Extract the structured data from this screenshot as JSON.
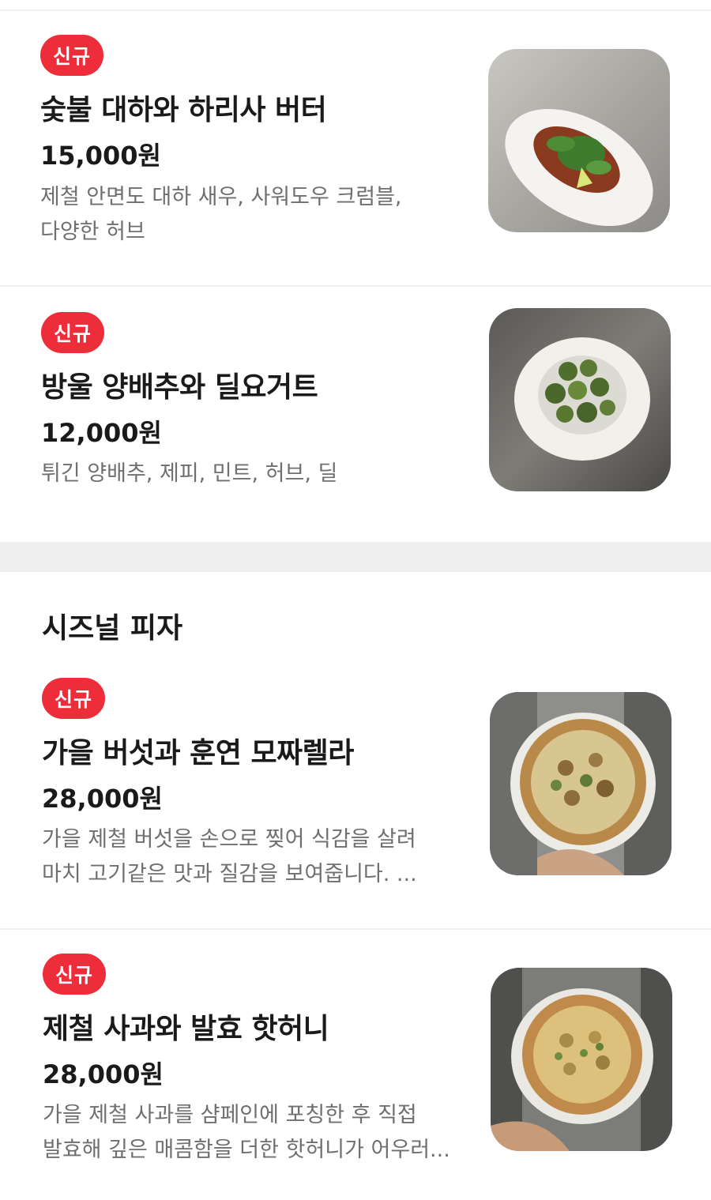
{
  "sections": [
    {
      "title": "",
      "items": [
        {
          "badge": "신규",
          "name": "숯불 대하와 하리사 버터",
          "price": "15,000원",
          "description": "제철 안면도 대하 새우, 사워도우 크럼블,\n다양한 허브"
        },
        {
          "badge": "신규",
          "name": "방울 양배추와 딜요거트",
          "price": "12,000원",
          "description": "튀긴 양배추, 제피, 민트, 허브, 딜"
        }
      ]
    },
    {
      "title": "시즈널 피자",
      "items": [
        {
          "badge": "신규",
          "name": "가을 버섯과 훈연 모짜렐라",
          "price": "28,000원",
          "description": "가을 제철 버섯을 손으로 찢어 식감을 살려\n마치 고기같은 맛과 질감을 보여줍니다. ..."
        },
        {
          "badge": "신규",
          "name": "제철 사과와 발효 핫허니",
          "price": "28,000원",
          "description": "가을 제철 사과를 샴페인에 포칭한 후 직접\n발효해 깊은 매콤함을 더한 핫허니가 어우러..."
        }
      ]
    }
  ],
  "colors": {
    "badge": "#ee2d3a",
    "text": "#1a1a1a",
    "muted": "#6f6f6f",
    "divider": "#efefef"
  }
}
